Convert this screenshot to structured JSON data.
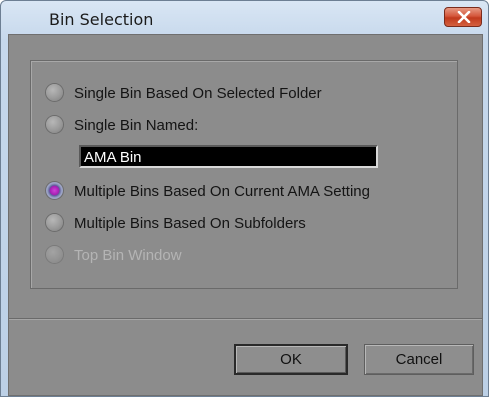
{
  "window": {
    "title": "Bin Selection",
    "close_icon": "close-x-icon"
  },
  "options": [
    {
      "label": "Single Bin Based On Selected Folder",
      "checked": false,
      "enabled": true
    },
    {
      "label": "Single Bin Named:",
      "checked": false,
      "enabled": true
    },
    {
      "label": "Multiple Bins Based On Current AMA Setting",
      "checked": true,
      "enabled": true
    },
    {
      "label": "Multiple Bins Based On Subfolders",
      "checked": false,
      "enabled": true
    },
    {
      "label": "Top Bin Window",
      "checked": false,
      "enabled": false
    }
  ],
  "bin_name": {
    "value": "AMA Bin"
  },
  "buttons": {
    "ok_label": "OK",
    "cancel_label": "Cancel"
  },
  "colors": {
    "client_bg": "#8c8c8c",
    "selected_radio": "#a21fb0",
    "close_button": "#c13a1d"
  }
}
